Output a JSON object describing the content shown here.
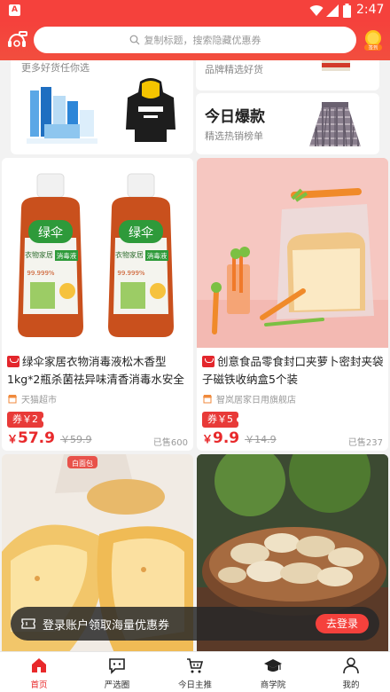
{
  "status_bar": {
    "time": "2:47",
    "app_badge": "A"
  },
  "header": {
    "search_placeholder": "复制标题，搜索隐藏优惠券",
    "coin_label": "签到"
  },
  "top_panel": {
    "left_subtitle": "更多好货任你选",
    "right_top_subtitle": "品牌精选好货",
    "right_title": "今日爆款",
    "right_subtitle": "精选热销榜单"
  },
  "products": [
    {
      "title": "绿伞家居衣物消毒液松木香型1kg*2瓶杀菌祛异味清香消毒水安全",
      "shop": "天猫超市",
      "coupon": "券￥2",
      "currency": "￥",
      "price": "57.9",
      "old_price": "￥59.9",
      "sold": "已售600",
      "img_text_brand": "绿伞",
      "img_text_type": "衣物家居",
      "img_text_product": "消毒液",
      "img_text_rate": "99.999%"
    },
    {
      "title": "创意食品零食封口夹萝卜密封夹袋子磁铁收纳盒5个装",
      "shop": "智岚居家日用旗舰店",
      "coupon": "券￥5",
      "currency": "￥",
      "price": "9.9",
      "old_price": "￥14.9",
      "sold": "已售237"
    },
    {
      "img_label": "白面包"
    },
    {}
  ],
  "login_banner": {
    "text": "登录账户领取海量优惠券",
    "button": "去登录"
  },
  "tabs": [
    {
      "label": "首页",
      "icon": "home-icon",
      "active": true
    },
    {
      "label": "严选圈",
      "icon": "chat-icon"
    },
    {
      "label": "今日主推",
      "icon": "cart-icon"
    },
    {
      "label": "商学院",
      "icon": "graduation-cap-icon"
    },
    {
      "label": "我的",
      "icon": "person-icon"
    }
  ],
  "colors": {
    "accent": "#f5413c",
    "price": "#e8292b",
    "coupon": "#e83a38"
  }
}
